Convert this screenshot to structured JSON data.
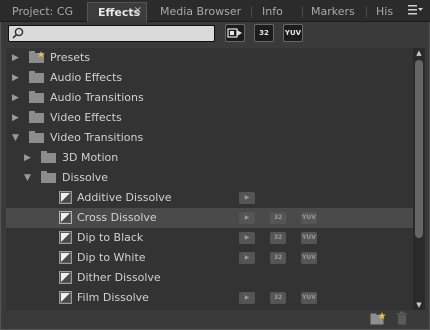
{
  "tabs": [
    {
      "label": "Project: CG",
      "active": false
    },
    {
      "label": "Effects",
      "active": true
    },
    {
      "label": "Media Browser",
      "active": false
    },
    {
      "label": "Info",
      "active": false
    },
    {
      "label": "Markers",
      "active": false
    },
    {
      "label": "His",
      "active": false
    }
  ],
  "tab_close_glyph": "×",
  "toolbar": {
    "search_value": "",
    "accel_label": "▶",
    "bit32_label": "32",
    "yuv_label": "YUV"
  },
  "tree": {
    "items": [
      {
        "label": "Presets",
        "type": "folder",
        "expanded": false,
        "level": 0,
        "special": true
      },
      {
        "label": "Audio Effects",
        "type": "folder",
        "expanded": false,
        "level": 0
      },
      {
        "label": "Audio Transitions",
        "type": "folder",
        "expanded": false,
        "level": 0
      },
      {
        "label": "Video Effects",
        "type": "folder",
        "expanded": false,
        "level": 0
      },
      {
        "label": "Video Transitions",
        "type": "folder",
        "expanded": true,
        "level": 0
      },
      {
        "label": "3D Motion",
        "type": "folder",
        "expanded": false,
        "level": 1
      },
      {
        "label": "Dissolve",
        "type": "folder",
        "expanded": true,
        "level": 1
      },
      {
        "label": "Additive Dissolve",
        "type": "effect",
        "level": 2,
        "badges": [
          "accel"
        ]
      },
      {
        "label": "Cross Dissolve",
        "type": "effect",
        "level": 2,
        "selected": true,
        "badges": [
          "accel",
          "32",
          "yuv"
        ]
      },
      {
        "label": "Dip to Black",
        "type": "effect",
        "level": 2,
        "badges": [
          "accel",
          "32",
          "yuv"
        ]
      },
      {
        "label": "Dip to White",
        "type": "effect",
        "level": 2,
        "badges": [
          "accel",
          "32",
          "yuv"
        ]
      },
      {
        "label": "Dither Dissolve",
        "type": "effect",
        "level": 2,
        "badges": []
      },
      {
        "label": "Film Dissolve",
        "type": "effect",
        "level": 2,
        "badges": [
          "accel",
          "32",
          "yuv"
        ]
      }
    ]
  },
  "badge_labels": {
    "accel": "▶",
    "32": "32",
    "yuv": "YUV"
  },
  "colors": {
    "folder": "#8c8c8c",
    "preset_star": "#e8c040",
    "selection": "#4a4a4a"
  }
}
